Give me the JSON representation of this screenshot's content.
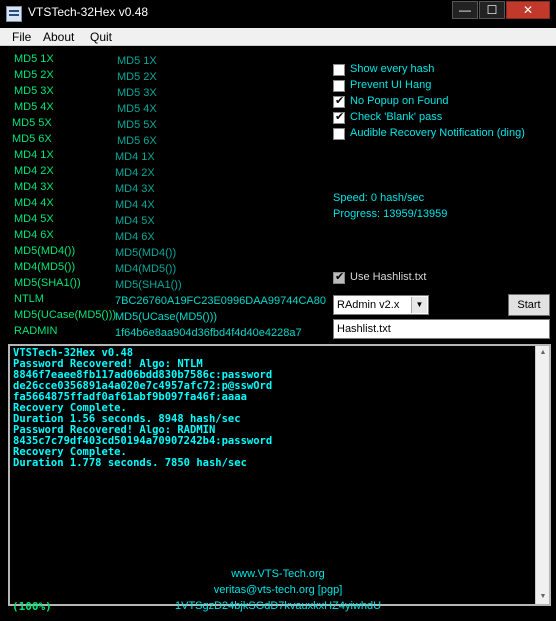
{
  "window": {
    "title": "VTSTech-32Hex v0.48",
    "minimize": "—",
    "maximize": "☐",
    "close": "✕"
  },
  "menu": [
    "File",
    "About",
    "Quit"
  ],
  "algos": [
    {
      "label": "MD5 1X",
      "value": "MD5 1X"
    },
    {
      "label": "MD5 2X",
      "value": "MD5 2X"
    },
    {
      "label": "MD5 3X",
      "value": "MD5 3X"
    },
    {
      "label": "MD5 4X",
      "value": "MD5 4X"
    },
    {
      "label": "MD5 5X",
      "value": "MD5 5X"
    },
    {
      "label": "MD5 6X",
      "value": "MD5 6X"
    },
    {
      "label": "MD4 1X",
      "value": "MD4 1X"
    },
    {
      "label": "MD4 2X",
      "value": "MD4 2X"
    },
    {
      "label": "MD4 3X",
      "value": "MD4 3X"
    },
    {
      "label": "MD4 4X",
      "value": "MD4 4X"
    },
    {
      "label": "MD4 5X",
      "value": "MD4 5X"
    },
    {
      "label": "MD4 6X",
      "value": "MD4 6X"
    },
    {
      "label": "MD5(MD4())",
      "value": "MD5(MD4())"
    },
    {
      "label": "MD4(MD5())",
      "value": "MD4(MD5())"
    },
    {
      "label": "MD5(SHA1())",
      "value": "MD5(SHA1())"
    },
    {
      "label": "NTLM",
      "value": "7BC26760A19FC23E0996DAA99744CA80"
    },
    {
      "label": "MD5(UCase(MD5()))",
      "value": "MD5(UCase(MD5()))"
    },
    {
      "label": "RADMIN",
      "value": "1f64b6e8aa904d36fbd4f4d40e4228a7"
    }
  ],
  "options": [
    {
      "label": "Show every hash",
      "checked": false
    },
    {
      "label": "Prevent UI Hang",
      "checked": false
    },
    {
      "label": "No Popup on Found",
      "checked": true
    },
    {
      "label": "Check 'Blank' pass",
      "checked": true
    },
    {
      "label": "Audible Recovery Notification (ding)",
      "checked": false
    }
  ],
  "status": {
    "speed": "Speed: 0 hash/sec",
    "progress": "Progress: 13959/13959"
  },
  "hashlist_option": {
    "label": "Use Hashlist.txt",
    "checked": true
  },
  "algo_select": {
    "value": "RAdmin v2.x"
  },
  "start_button": "Start",
  "hashlist_field": {
    "value": "Hashlist.txt"
  },
  "log": [
    "VTSTech-32Hex v0.48",
    "Password Recovered! Algo: NTLM",
    "8846f7eaee8fb117ad06bdd830b7586c:password",
    "de26cce0356891a4a020e7c4957afc72:p@sswOrd",
    "fa5664875ffadf0af61abf9b097fa46f:aaaa",
    "Recovery Complete.",
    "Duration 1.56 seconds. 8948 hash/sec",
    "Password Recovered! Algo: RADMIN",
    "8435c7c79df403cd50194a70907242b4:password",
    "Recovery Complete.",
    "Duration 1.778 seconds. 7850 hash/sec"
  ],
  "footer": {
    "site": "www.VTS-Tech.org",
    "email": "veritas@vts-tech.org  [pgp]",
    "key": "1VTSgzD24bjkSGdD7kvauxkxHZ4yiwhdU",
    "percent": "(100%)"
  }
}
